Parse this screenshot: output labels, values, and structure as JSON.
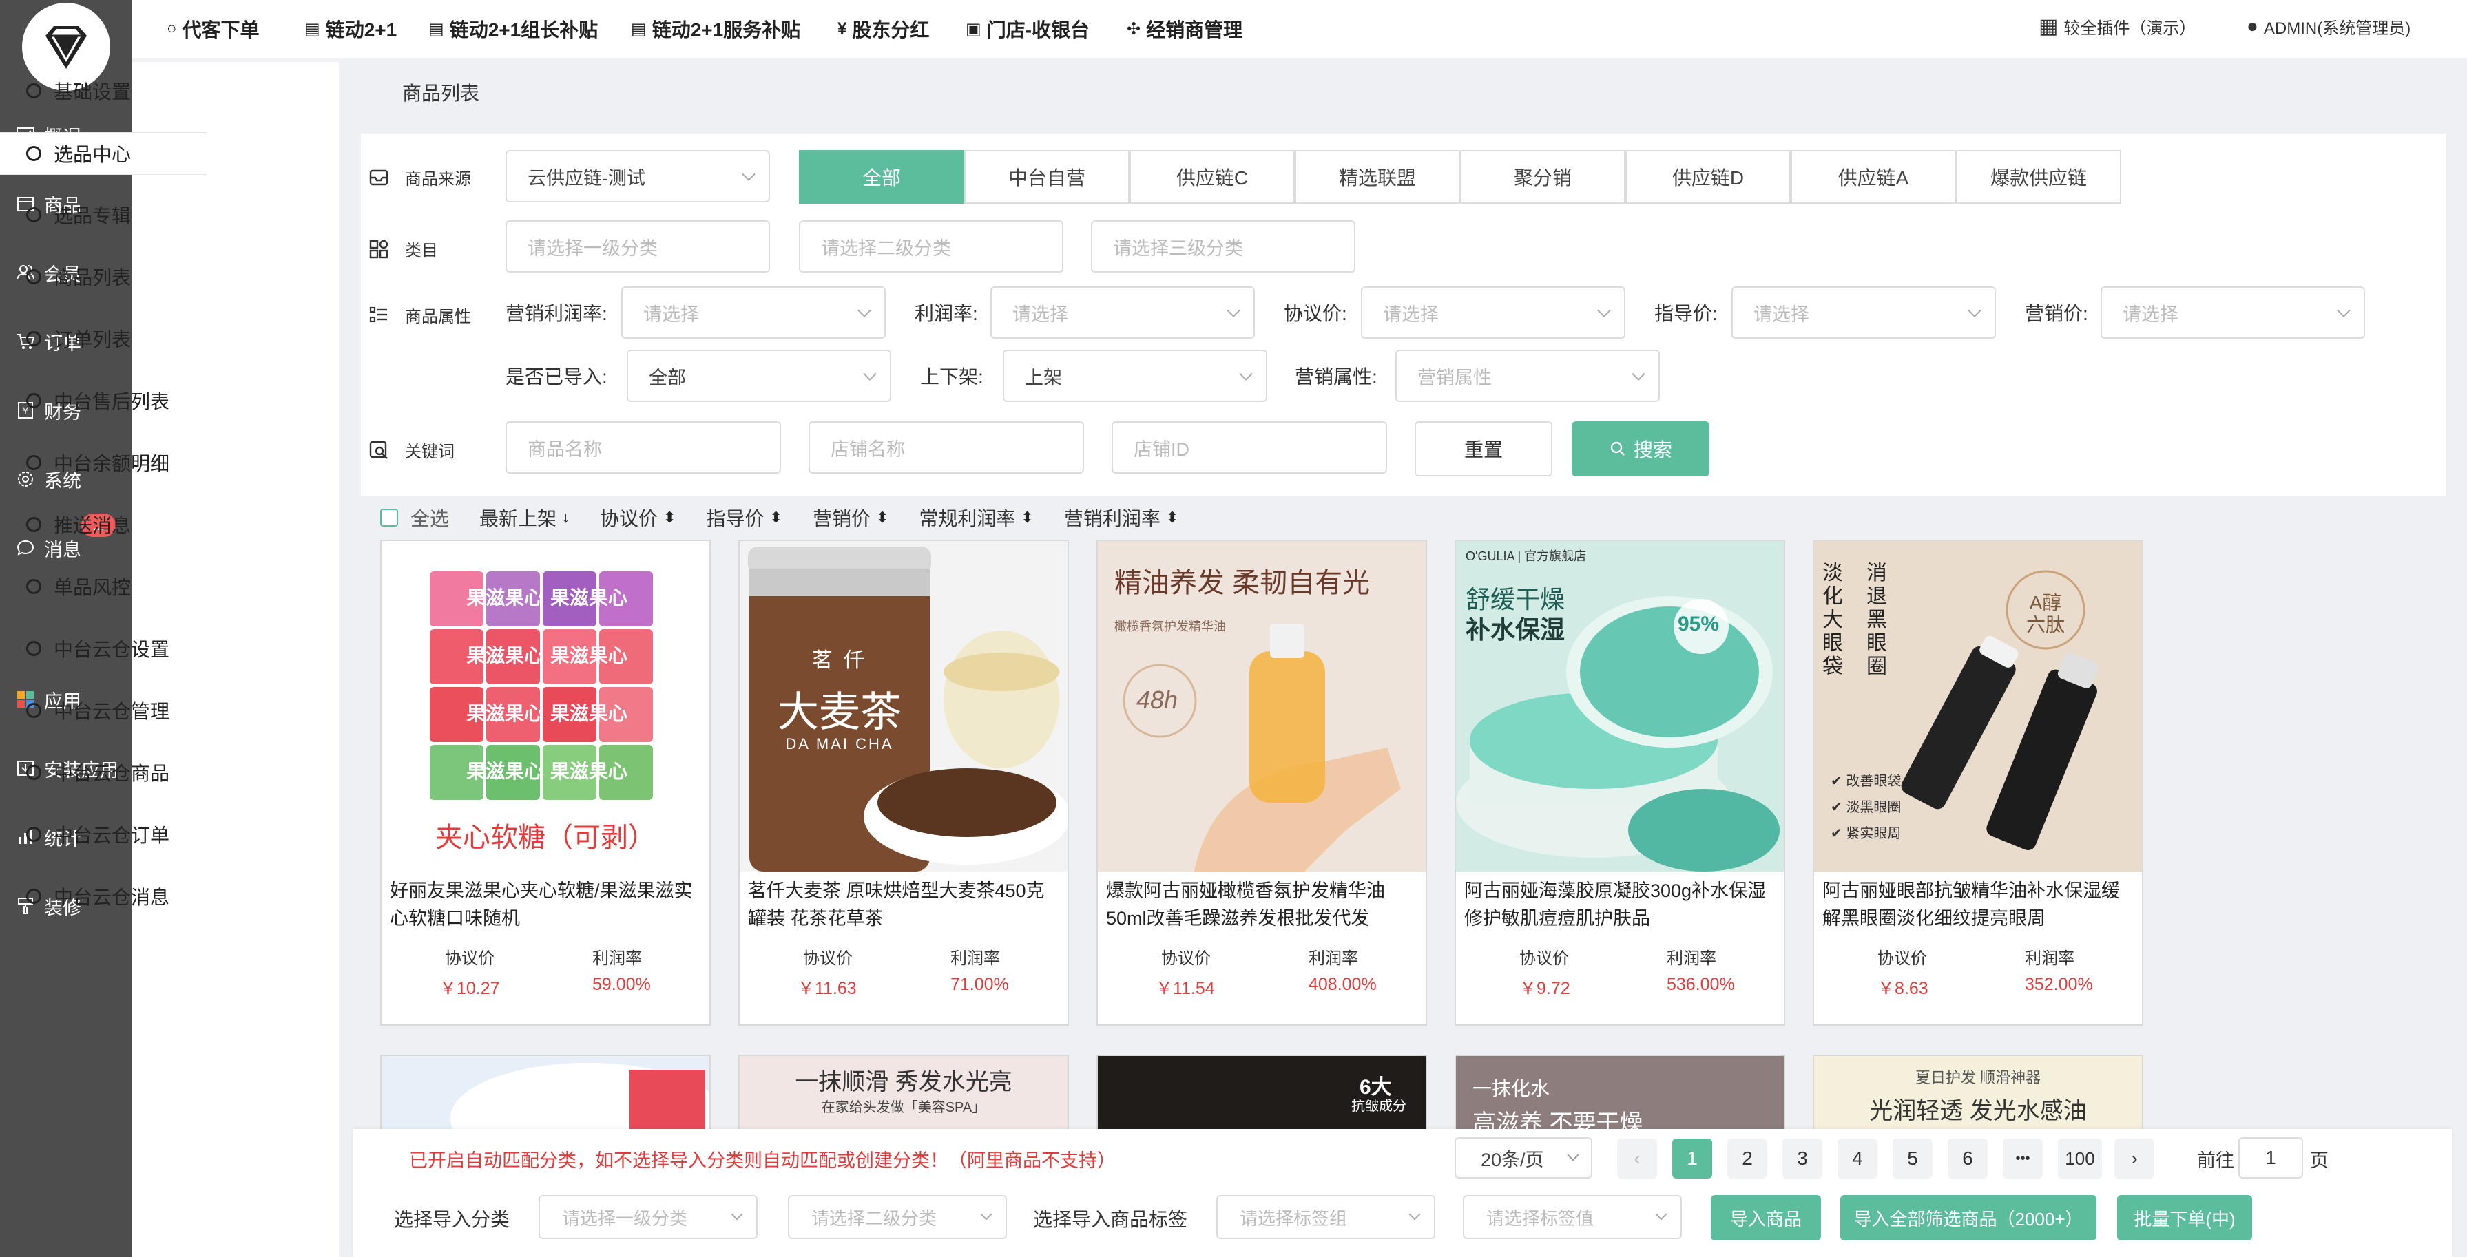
{
  "rail": {
    "items": [
      {
        "label": "概况",
        "icon": "chart-icon"
      },
      {
        "label": "商品",
        "icon": "box-icon"
      },
      {
        "label": "会员",
        "icon": "users-icon"
      },
      {
        "label": "订单",
        "icon": "cart-icon"
      },
      {
        "label": "财务",
        "icon": "wallet-icon"
      },
      {
        "label": "系统",
        "icon": "gear-icon"
      },
      {
        "label": "消息",
        "icon": "chat-icon"
      },
      {
        "label": "应用",
        "icon": "apps-icon"
      },
      {
        "label": "安装应用",
        "icon": "install-icon"
      },
      {
        "label": "统计",
        "icon": "stats-icon"
      },
      {
        "label": "装修",
        "icon": "brush-icon"
      }
    ],
    "badge": "..."
  },
  "sidebar": {
    "items": [
      "基础设置",
      "选品中心",
      "选品专辑",
      "商品列表",
      "订单列表",
      "中台售后列表",
      "中台余额明细",
      "推送消息",
      "单品风控",
      "中台云仓设置",
      "中台云仓管理",
      "中台云仓商品",
      "中台云仓订单",
      "中台云仓消息"
    ]
  },
  "topnav": {
    "items": [
      "代客下单",
      "链动2+1",
      "链动2+1组长补贴",
      "链动2+1服务补贴",
      "股东分红",
      "门店-收银台",
      "经销商管理"
    ],
    "plugin": "较全插件（演示）",
    "user": "ADMIN(系统管理员)"
  },
  "breadcrumb": "商品列表",
  "filters": {
    "source_label": "商品来源",
    "source_value": "云供应链-测试",
    "source_tabs": [
      "全部",
      "中台自营",
      "供应链C",
      "精选联盟",
      "聚分销",
      "供应链D",
      "供应链A",
      "爆款供应链"
    ],
    "category_label": "类目",
    "cat1": "请选择一级分类",
    "cat2": "请选择二级分类",
    "cat3": "请选择三级分类",
    "attr_label": "商品属性",
    "attrs": [
      {
        "label": "营销利润率:",
        "placeholder": "请选择"
      },
      {
        "label": "利润率:",
        "placeholder": "请选择"
      },
      {
        "label": "协议价:",
        "placeholder": "请选择"
      },
      {
        "label": "指导价:",
        "placeholder": "请选择"
      },
      {
        "label": "营销价:",
        "placeholder": "请选择"
      }
    ],
    "imported_label": "是否已导入:",
    "imported_value": "全部",
    "shelf_label": "上下架:",
    "shelf_value": "上架",
    "mkt_label": "营销属性:",
    "mkt_placeholder": "营销属性",
    "keyword_label": "关键词",
    "kw_name": "商品名称",
    "kw_shop": "店铺名称",
    "kw_shopid": "店铺ID",
    "reset": "重置",
    "search": "搜索"
  },
  "sort": {
    "select_all": "全选",
    "items": [
      "最新上架",
      "协议价",
      "指导价",
      "营销价",
      "常规利润率",
      "营销利润率"
    ]
  },
  "products": [
    {
      "name": "好丽友果滋果心夹心软糖/果滋果滋实心软糖口味随机",
      "price_label": "协议价",
      "price": "￥10.27",
      "rate_label": "利润率",
      "rate": "59.00%",
      "img_text": "夹心软糖（可剥）",
      "img_sub": "果滋果心"
    },
    {
      "name": "茗仟大麦茶 原味烘焙型大麦茶450克罐装 花茶花草茶",
      "price_label": "协议价",
      "price": "￥11.63",
      "rate_label": "利润率",
      "rate": "71.00%",
      "img_text": "大麦茶",
      "img_sub": "茗 仟",
      "img_sub2": "DA MAI CHA"
    },
    {
      "name": "爆款阿古丽娅橄榄香氛护发精华油50ml改善毛躁滋养发根批发代发",
      "price_label": "协议价",
      "price": "￥11.54",
      "rate_label": "利润率",
      "rate": "408.00%",
      "img_text": "精油养发 柔韧自有光",
      "img_sub": "橄榄香氛护发精华油",
      "img_sub2": "48h"
    },
    {
      "name": "阿古丽娅海藻胶原凝胶300g补水保湿修护敏肌痘痘肌护肤品",
      "price_label": "协议价",
      "price": "￥9.72",
      "rate_label": "利润率",
      "rate": "536.00%",
      "img_text": "舒缓干燥",
      "img_sub": "补水保湿",
      "img_sub2": "O'GULIA | 官方旗舰店",
      "img_badge": "95%"
    },
    {
      "name": "阿古丽娅眼部抗皱精华油补水保湿缓解黑眼圈淡化细纹提亮眼周",
      "price_label": "协议价",
      "price": "￥8.63",
      "rate_label": "利润率",
      "rate": "352.00%",
      "img_text": "淡化大眼袋",
      "img_sub": "消退黑眼圈",
      "img_badge": "A醇六肽",
      "bullets": [
        "改善眼袋",
        "淡黑眼圈",
        "紧实眼周"
      ]
    }
  ],
  "products_row2": [
    {
      "img_text": ""
    },
    {
      "img_text": "一抹顺滑 秀发水光亮",
      "img_sub": "在家给头发做「美容SPA」"
    },
    {
      "img_text": "6大",
      "img_sub": "抗皱成分"
    },
    {
      "img_text": "一抹化水",
      "img_sub": "高滋养 不要干燥"
    },
    {
      "img_text": "光润轻透 发光水感油",
      "img_sub": "夏日护发 顺滑神器"
    }
  ],
  "bottom": {
    "warning": "已开启自动匹配分类，如不选择导入分类则自动匹配或创建分类！（阿里商品不支持）",
    "page_size": "20条/页",
    "pages": [
      "1",
      "2",
      "3",
      "4",
      "5",
      "6",
      "•••",
      "100"
    ],
    "goto_prefix": "前往",
    "goto_value": "1",
    "goto_suffix": "页",
    "import_cat_label": "选择导入分类",
    "import_cat1": "请选择一级分类",
    "import_cat2": "请选择二级分类",
    "tag_label": "选择导入商品标签",
    "tag_group": "请选择标签组",
    "tag_value": "请选择标签值",
    "btn_import": "导入商品",
    "btn_import_all": "导入全部筛选商品（2000+）",
    "btn_batch": "批量下单(中)"
  }
}
